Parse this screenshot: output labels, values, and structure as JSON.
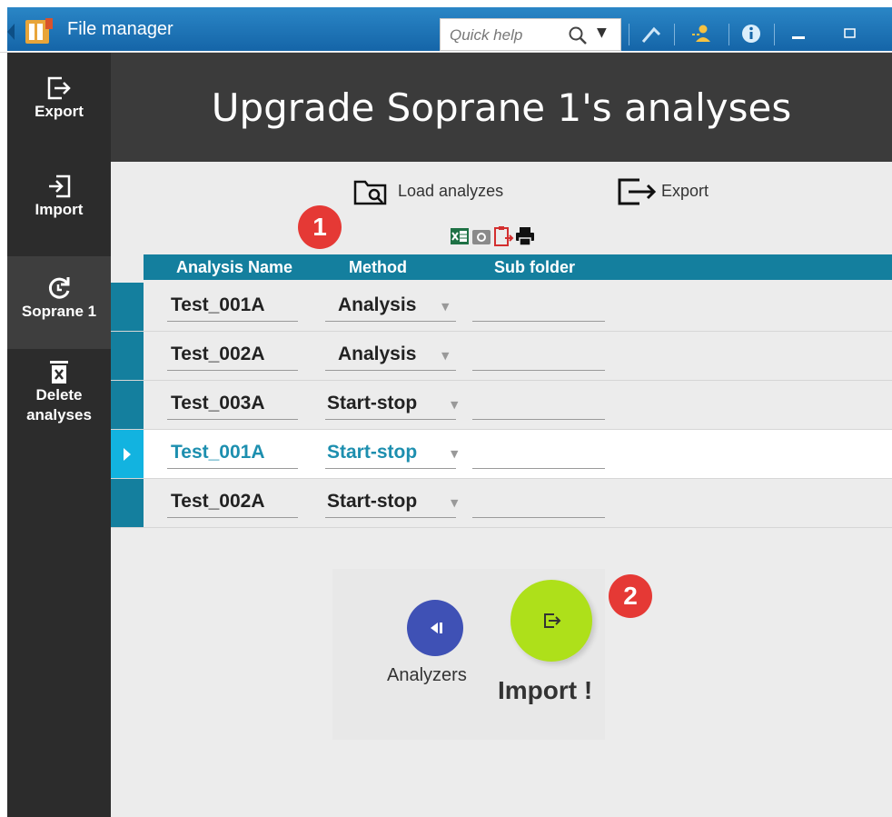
{
  "window": {
    "title": "File manager",
    "quick_help_placeholder": "Quick help"
  },
  "sidebar": {
    "items": [
      {
        "label": "Export",
        "icon": "export-icon"
      },
      {
        "label": "Import",
        "icon": "import-icon"
      },
      {
        "label": "Soprane 1",
        "icon": "refresh-icon",
        "active": true
      },
      {
        "label": "Delete analyses",
        "icon": "delete-icon"
      }
    ]
  },
  "header": {
    "title": "Upgrade Soprane 1's analyses"
  },
  "toolbar": {
    "load_label": "Load analyzes",
    "export_label": "Export"
  },
  "markers": [
    "1",
    "2"
  ],
  "grid": {
    "columns": [
      "Analysis Name",
      "Method",
      "Sub folder"
    ],
    "rows": [
      {
        "name": "Test_001A",
        "method": "Analysis",
        "sub_folder": "",
        "selected": false
      },
      {
        "name": "Test_002A",
        "method": "Analysis",
        "sub_folder": "",
        "selected": false
      },
      {
        "name": "Test_003A",
        "method": "Start-stop",
        "sub_folder": "",
        "selected": false
      },
      {
        "name": "Test_001A",
        "method": "Start-stop",
        "sub_folder": "",
        "selected": true
      },
      {
        "name": "Test_002A",
        "method": "Start-stop",
        "sub_folder": "",
        "selected": false
      }
    ]
  },
  "actions": {
    "analyzers_label": "Analyzers",
    "import_label": "Import !"
  },
  "colors": {
    "accent": "#147f9e",
    "selected_row_accent": "#12b3e0",
    "marker_red": "#e53935",
    "import_button": "#aee01a",
    "analyzers_button": "#3f51b5",
    "sidebar_bg": "#2c2c2c",
    "header_bg": "#3b3b3b",
    "titlebar_blue": "#1f77bb"
  }
}
